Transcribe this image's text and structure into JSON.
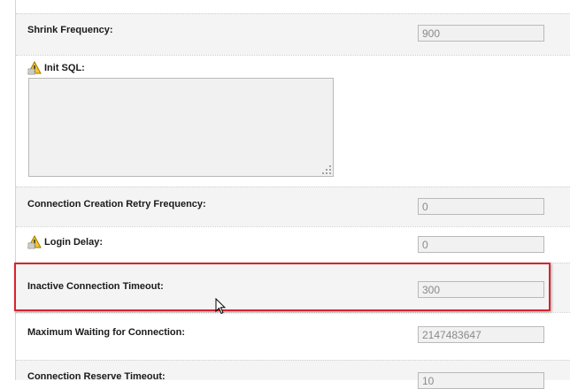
{
  "rows": {
    "shrink_frequency": {
      "label": "Shrink Frequency:",
      "value": "900"
    },
    "init_sql": {
      "label": "Init SQL:",
      "value": ""
    },
    "connection_creation_retry_frequency": {
      "label": "Connection Creation Retry Frequency:",
      "value": "0"
    },
    "login_delay": {
      "label": "Login Delay:",
      "value": "0"
    },
    "inactive_connection_timeout": {
      "label": "Inactive Connection Timeout:",
      "value": "300"
    },
    "maximum_waiting_for_connection": {
      "label": "Maximum Waiting for Connection:",
      "value": "2147483647"
    },
    "connection_reserve_timeout": {
      "label": "Connection Reserve Timeout:",
      "value": "10"
    }
  },
  "icons": {
    "warning": "warning-icon",
    "resize": "resize-grip-icon",
    "cursor": "mouse-cursor-icon"
  },
  "colors": {
    "highlight": "#d9232e",
    "row_shaded": "#f4f4f4",
    "field_bg": "#f1f1f1",
    "field_text": "#8a8a8a"
  }
}
